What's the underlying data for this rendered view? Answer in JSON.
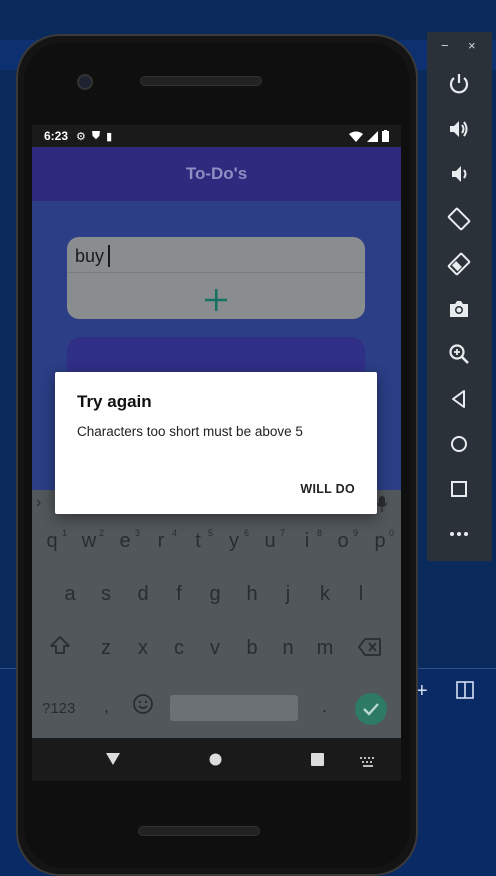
{
  "status_bar": {
    "time": "6:23"
  },
  "app": {
    "title": "To-Do's"
  },
  "input": {
    "value": "buy"
  },
  "dialog": {
    "title": "Try again",
    "message": "Characters too short must be above 5",
    "button": "WILL DO"
  },
  "keyboard": {
    "row1": [
      "q",
      "w",
      "e",
      "r",
      "t",
      "y",
      "u",
      "i",
      "o",
      "p"
    ],
    "row1_nums": [
      "1",
      "2",
      "3",
      "4",
      "5",
      "6",
      "7",
      "8",
      "9",
      "0"
    ],
    "row2": [
      "a",
      "s",
      "d",
      "f",
      "g",
      "h",
      "j",
      "k",
      "l"
    ],
    "row3": [
      "z",
      "x",
      "c",
      "v",
      "b",
      "n",
      "m"
    ],
    "symbols_key": "?123",
    "comma": ",",
    "period": "."
  },
  "emulator_toolbar": {
    "minimize": "−",
    "close": "×",
    "buttons": [
      "power-icon",
      "volume-up-icon",
      "volume-down-icon",
      "rotate-left-icon",
      "rotate-right-icon",
      "camera-icon",
      "zoom-icon",
      "back-icon",
      "home-icon",
      "overview-icon",
      "more-icon"
    ]
  },
  "colors": {
    "appbar": "#302a7e",
    "accent": "#157060",
    "content": "#2b3e86"
  }
}
